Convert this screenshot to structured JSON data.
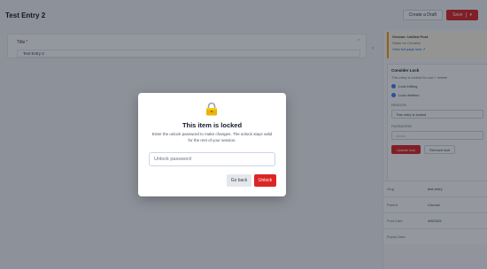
{
  "page": {
    "title": "Test Entry 2",
    "actions": {
      "create_label": "Create a Draft",
      "save_label": "Save"
    }
  },
  "editor": {
    "field_label": "Title",
    "field_value": "Test Entry 2"
  },
  "sidebar": {
    "notice": {
      "line1": "Version: Unified Post",
      "line2": "Stash for Creative",
      "link": "View full page lock ↗"
    },
    "lock_panel": {
      "title": "Consider Lock",
      "subtitle": "This entry is locked for use + delete",
      "check_editing": "Lock editing",
      "check_deletion": "Lock deletion",
      "reason_label": "REASON",
      "reason_value": "This entry is locked",
      "password_label": "PASSWORD",
      "password_placeholder": "••••••••",
      "update_label": "Update lock",
      "remove_label": "Remove lock"
    },
    "meta": [
      {
        "key": "Slug",
        "value": "test-entry"
      },
      {
        "key": "Parent",
        "value": "Choose"
      },
      {
        "key": "Post Date",
        "value": "4/8/2026"
      },
      {
        "key": "Expiry Date",
        "value": ""
      }
    ]
  },
  "modal": {
    "icon": "lock-icon",
    "title": "This item is locked",
    "description": "Enter the unlock password to make changes. The unlock stays valid for the rest of your session.",
    "input_placeholder": "Unlock password",
    "back_label": "Go back",
    "unlock_label": "Unlock"
  },
  "colors": {
    "accent": "#dc2626",
    "overlay": "rgba(17,24,39,0.45)",
    "notice_border": "#f59e0b"
  }
}
